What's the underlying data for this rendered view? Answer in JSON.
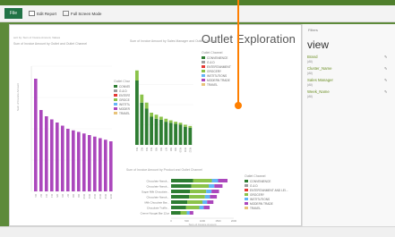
{
  "ribbon": {
    "file_tab": "File",
    "edit_report": "Edit Report",
    "full_screen": "Full Screen Mode"
  },
  "canvas": {
    "title": "Outlet Exploration",
    "chart1": {
      "title": "Sum of Invoice Amount by Outlet and Outlet Channel",
      "sort": "sort by: Sum of Invoice Amount, Values",
      "ylabel": "Sum of Invoice Amount"
    },
    "chart2": {
      "title": "Sum of Invoice Amount by Sales Manager and Outlet Channel"
    },
    "chart3": {
      "title": "Sum of Invoice Amount by Product and Outlet Channel",
      "xlabel": "Sum of Invoice Amount"
    }
  },
  "side": {
    "filters_label": "Filters",
    "view_label": "view",
    "fields": [
      {
        "name": "Brand",
        "value": "(All)"
      },
      {
        "name": "Cluster_Name",
        "value": "(All)"
      },
      {
        "name": "Sales Manager",
        "value": "(All)"
      },
      {
        "name": "Week_Name",
        "value": "(All)"
      }
    ]
  },
  "status": {
    "left": "",
    "right": ""
  },
  "colors": {
    "ribbon_accent": "#217346",
    "series": {
      "CONVENIENCE": "#2e7d32",
      "G & D": "#9e9e9e",
      "ENTERTAINMENT": "#e53935",
      "GROCERY": "#8bc34a",
      "INSTITUTIONS": "#64b5f6",
      "MODERN TRADE": "#ab47bc",
      "TRAVEL": "#e8c37a"
    }
  },
  "chart_data": [
    {
      "type": "bar",
      "title": "Sum of Invoice Amount by Outlet and Outlet Channel",
      "ylabel": "Sum of Invoice Amount",
      "ylim": [
        0,
        4000
      ],
      "categories": [
        "O1",
        "O2",
        "O3",
        "O4",
        "O5",
        "O6",
        "O7",
        "O8",
        "O9",
        "O10",
        "O11",
        "O12",
        "O13",
        "O14",
        "O15"
      ],
      "series": [
        {
          "name": "MODERN TRADE",
          "values": [
            3600,
            2600,
            2400,
            2300,
            2200,
            2100,
            2000,
            1950,
            1900,
            1850,
            1800,
            1750,
            1700,
            1650,
            1600
          ],
          "color": "#ab47bc"
        },
        {
          "name": "GROCERY",
          "values": [
            0,
            0,
            0,
            0,
            0,
            0,
            0,
            0,
            0,
            0,
            0,
            0,
            0,
            0,
            0
          ],
          "color": "#8bc34a"
        }
      ],
      "legend": {
        "title": "Outlet Channel",
        "entries": [
          "CONVENIENCE",
          "G & D",
          "ENTERTAINMENT",
          "GROCERY",
          "INSTITUTIONS",
          "MODERN TRADE",
          "TRAVEL"
        ]
      }
    },
    {
      "type": "bar",
      "title": "Sum of Invoice Amount by Sales Manager and Outlet Channel",
      "ylim": [
        0,
        4000
      ],
      "categories": [
        "M1",
        "M2",
        "M3",
        "M4",
        "M5",
        "M6",
        "M7",
        "M8",
        "M9",
        "M10",
        "M11",
        "M12"
      ],
      "series": [
        {
          "name": "CONVENIENCE",
          "values": [
            3200,
            2100,
            1800,
            1400,
            1300,
            1250,
            1150,
            1100,
            1050,
            1000,
            900,
            850
          ],
          "color": "#2e7d32"
        },
        {
          "name": "GROCERY",
          "values": [
            500,
            400,
            300,
            200,
            200,
            150,
            150,
            120,
            100,
            100,
            100,
            90
          ],
          "color": "#8bc34a"
        },
        {
          "name": "ENTERTAINMENT",
          "values": [
            0,
            0,
            0,
            0,
            0,
            0,
            0,
            0,
            0,
            0,
            0,
            0
          ],
          "color": "#e53935"
        }
      ],
      "legend": {
        "title": "Outlet Channel",
        "entries": [
          "CONVENIENCE",
          "G & D",
          "ENTERTAINMENT",
          "GROCERY",
          "INSTITUTIONS",
          "MODERN TRADE",
          "TRAVEL"
        ]
      }
    },
    {
      "type": "bar",
      "orientation": "horizontal",
      "title": "Sum of Invoice Amount by Product and Outlet Channel",
      "xlabel": "Sum of Invoice Amount",
      "xlim": [
        0,
        2000
      ],
      "categories": [
        "Chocolate Nanuk...",
        "Chocolate Nanuk...",
        "Sugar Milk Chocolate...",
        "Chocolate Nanuk...",
        "Milk Chocolate Bar...",
        "Chocolate Truffle...",
        "Creme Nougat Bar 12oz"
      ],
      "series": [
        {
          "name": "CONVENIENCE",
          "values": [
            700,
            650,
            600,
            580,
            520,
            480,
            300
          ],
          "color": "#2e7d32"
        },
        {
          "name": "GROCERY",
          "values": [
            600,
            550,
            520,
            500,
            480,
            420,
            200
          ],
          "color": "#8bc34a"
        },
        {
          "name": "INSTITUTIONS",
          "values": [
            200,
            180,
            170,
            160,
            150,
            140,
            90
          ],
          "color": "#64b5f6"
        },
        {
          "name": "MODERN TRADE",
          "values": [
            300,
            260,
            240,
            220,
            200,
            190,
            120
          ],
          "color": "#ab47bc"
        }
      ],
      "legend": {
        "title": "Outlet Channel",
        "entries": [
          "CONVENIENCE",
          "G & D",
          "ENTERTAINMENT AND LEI...",
          "GROCERY",
          "INSTITUTIONS",
          "MODERN TRADE",
          "TRAVEL"
        ]
      }
    }
  ]
}
